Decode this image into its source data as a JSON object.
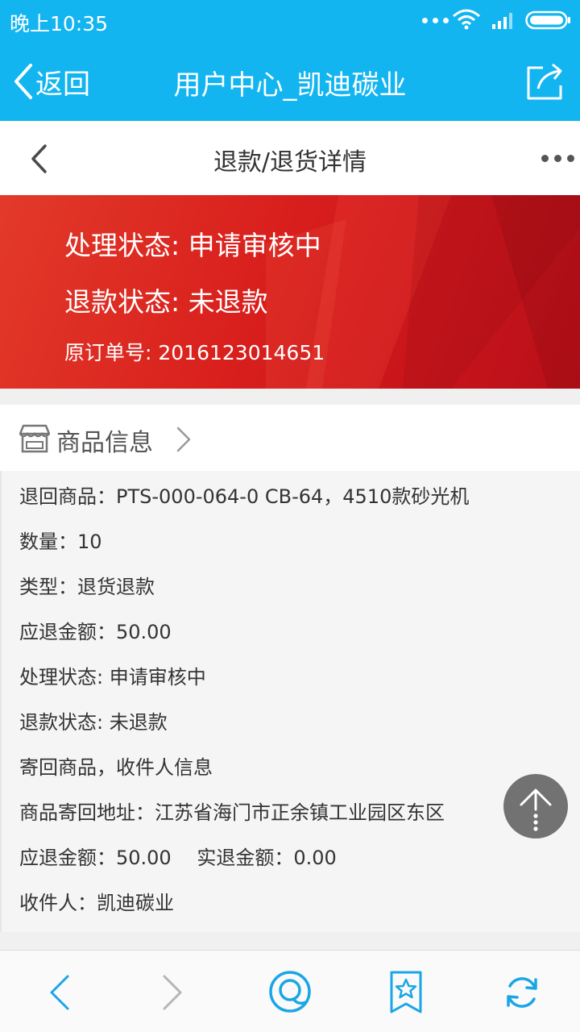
{
  "status_bar": {
    "time": "晚上10:35",
    "icons": [
      "dots-icon",
      "wifi-icon",
      "signal-icon",
      "battery-icon"
    ]
  },
  "app_header": {
    "back_label": "返回",
    "title": "用户中心_凯迪碳业",
    "share_icon": "share-icon"
  },
  "page_nav": {
    "title": "退款/退货详情",
    "back_icon": "chevron-left-icon",
    "more_icon": "more-icon"
  },
  "banner": {
    "process_status": "处理状态: 申请审核中",
    "refund_status": "退款状态: 未退款",
    "order_no": "原订单号: 2016123014651"
  },
  "product_section": {
    "title": "商品信息",
    "icon": "shop-icon"
  },
  "details": [
    "退回商品：PTS-000-064-0 CB-64，4510款砂光机",
    "数量：10",
    "类型：退货退款",
    "应退金额：50.00",
    "处理状态: 申请审核中",
    "退款状态: 未退款",
    "寄回商品，收件人信息",
    "商品寄回地址：江苏省海门市正余镇工业园区东区",
    "应退金额：50.00　 实退金额：0.00",
    "收件人：凯迪碳业"
  ],
  "colors": {
    "header_blue": "#13b5f0",
    "banner_red": "#d91f1c",
    "toolbar_blue": "#1aa6e6"
  },
  "bottom_toolbar": [
    "back-icon",
    "forward-icon",
    "chat-icon",
    "bookmark-icon",
    "refresh-icon"
  ]
}
